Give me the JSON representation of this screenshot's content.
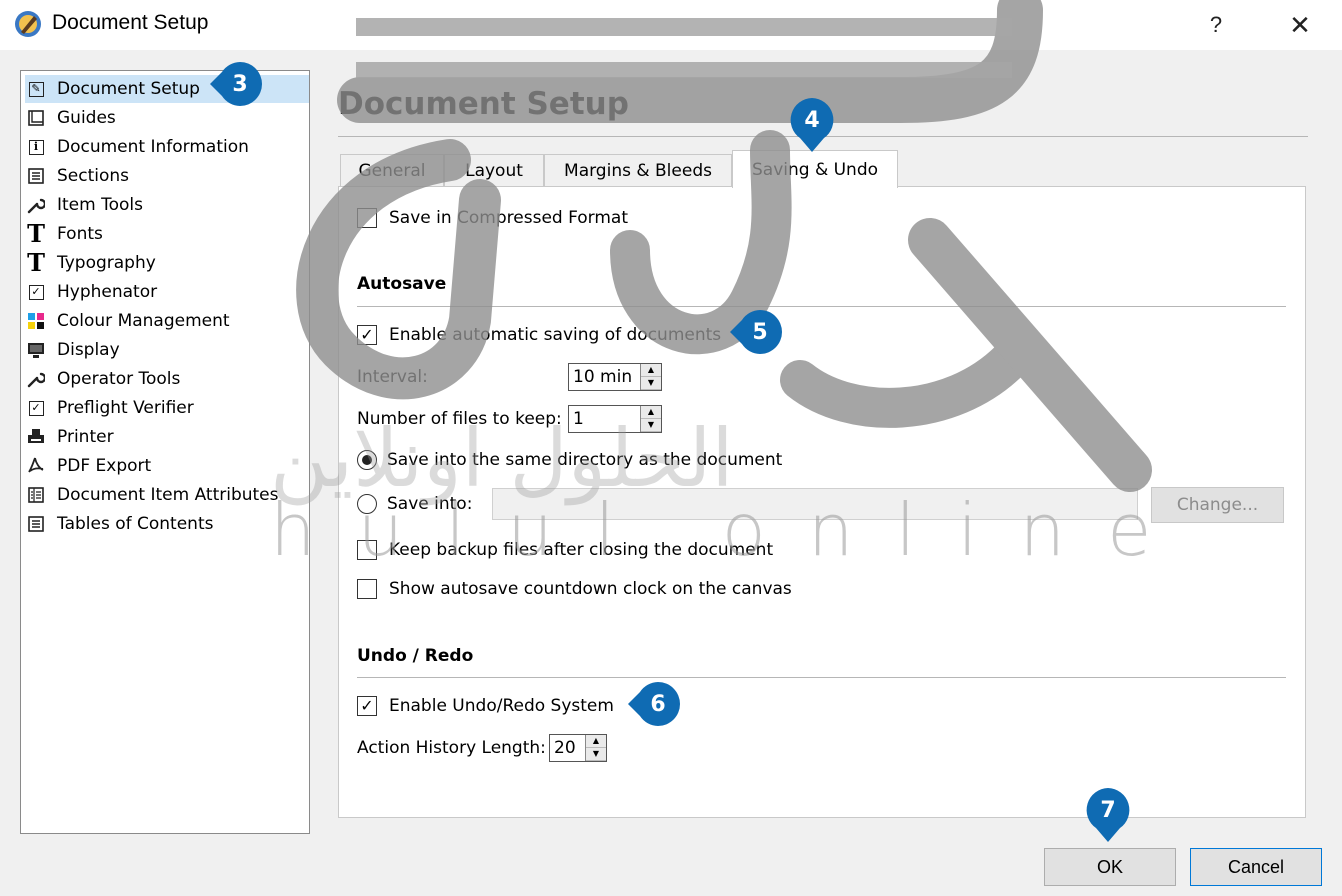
{
  "window": {
    "title": "Document Setup",
    "help": "?",
    "close": "✕"
  },
  "nav": {
    "items": [
      {
        "label": "Document Setup",
        "icon": "document-setup-icon",
        "selected": true
      },
      {
        "label": "Guides",
        "icon": "guides-icon"
      },
      {
        "label": "Document Information",
        "icon": "info-icon"
      },
      {
        "label": "Sections",
        "icon": "sections-icon"
      },
      {
        "label": "Item Tools",
        "icon": "wrench-icon"
      },
      {
        "label": "Fonts",
        "icon": "font-t-icon"
      },
      {
        "label": "Typography",
        "icon": "typography-t-icon"
      },
      {
        "label": "Hyphenator",
        "icon": "checkbox-icon"
      },
      {
        "label": "Colour Management",
        "icon": "colour-squares-icon"
      },
      {
        "label": "Display",
        "icon": "monitor-icon"
      },
      {
        "label": "Operator Tools",
        "icon": "wrench-icon"
      },
      {
        "label": "Preflight Verifier",
        "icon": "checkbox-icon"
      },
      {
        "label": "Printer",
        "icon": "printer-icon"
      },
      {
        "label": "PDF Export",
        "icon": "pdf-icon"
      },
      {
        "label": "Document Item Attributes",
        "icon": "attributes-icon"
      },
      {
        "label": "Tables of Contents",
        "icon": "toc-icon"
      }
    ]
  },
  "main": {
    "heading": "Document Setup",
    "tabs": [
      "General",
      "Layout",
      "Margins & Bleeds",
      "Saving & Undo"
    ],
    "active_tab": "Saving & Undo",
    "compressed": {
      "label": "Save in Compressed Format",
      "checked": false
    },
    "autosave": {
      "title": "Autosave",
      "enable": {
        "label": "Enable automatic saving of documents",
        "checked": true
      },
      "interval_label": "Interval:",
      "interval_value": "10 min",
      "files_label": "Number of files to keep:",
      "files_value": "1",
      "same_dir_label": "Save into the same directory as the document",
      "same_dir_selected": true,
      "save_into_label": "Save into:",
      "save_into_value": "",
      "change_label": "Change...",
      "keep_backup": {
        "label": "Keep backup files after closing the document",
        "checked": false
      },
      "countdown": {
        "label": "Show autosave countdown clock on the canvas",
        "checked": false
      }
    },
    "undo": {
      "title": "Undo / Redo",
      "enable": {
        "label": "Enable Undo/Redo System",
        "checked": true
      },
      "history_label": "Action History Length:",
      "history_value": "20"
    }
  },
  "buttons": {
    "ok": "OK",
    "cancel": "Cancel"
  },
  "callouts": [
    "3",
    "4",
    "5",
    "6",
    "7"
  ],
  "watermark": {
    "latin": "hulul online",
    "arabic": "الحلول اونلاين"
  },
  "colors": {
    "callout": "#0f6bb3",
    "selection": "#cce4f7",
    "watermark": "#9a9a9a"
  }
}
